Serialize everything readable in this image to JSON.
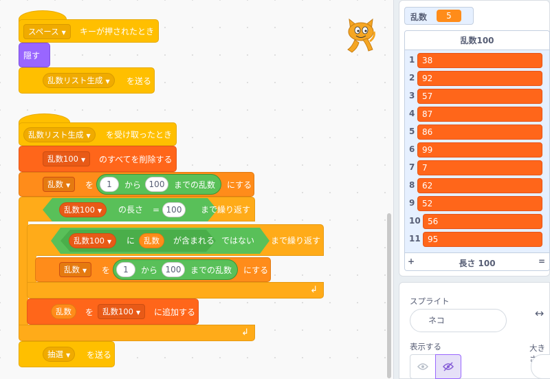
{
  "scripts": {
    "s1": {
      "hat_key_dropdown": "スペース",
      "hat_text": "キーが押されたとき",
      "hide_label": "隠す",
      "broadcast_dropdown": "乱数リスト生成",
      "broadcast_text": "を送る"
    },
    "s2": {
      "hat_dropdown": "乱数リスト生成",
      "hat_text": "を受け取ったとき",
      "delete_all_list": "乱数100",
      "delete_all_text": "のすべてを削除する",
      "set_var": "乱数",
      "set_to": "を",
      "rand_from": "1",
      "rand_kara": "から",
      "rand_to": "100",
      "rand_text": "までの乱数",
      "set_suffix": "にする",
      "repeat_until_list": "乱数100",
      "length_of": "の長さ",
      "eq": "=",
      "eq_value": "100",
      "repeat_until_text": "まで繰り返す",
      "inner_list": "乱数100",
      "ni": "に",
      "contains_var": "乱数",
      "contains_text": "が含まれる",
      "not_text": "ではない",
      "inner_repeat_text": "まで繰り返す",
      "inner_set_var": "乱数",
      "inner_set_to": "を",
      "inner_rand_from": "1",
      "inner_rand_kara": "から",
      "inner_rand_to": "100",
      "inner_rand_text": "までの乱数",
      "inner_set_suffix": "にする",
      "add_var": "乱数",
      "add_wo": "を",
      "add_list": "乱数100",
      "add_text": "に追加する",
      "broadcast_dropdown": "抽選",
      "broadcast_text": "を送る"
    }
  },
  "stage": {
    "var_monitor": {
      "name": "乱数",
      "value": "5"
    },
    "list_monitor": {
      "title": "乱数100",
      "items": [
        {
          "i": "1",
          "v": "38"
        },
        {
          "i": "2",
          "v": "92"
        },
        {
          "i": "3",
          "v": "57"
        },
        {
          "i": "4",
          "v": "87"
        },
        {
          "i": "5",
          "v": "86"
        },
        {
          "i": "6",
          "v": "99"
        },
        {
          "i": "7",
          "v": "7"
        },
        {
          "i": "8",
          "v": "62"
        },
        {
          "i": "9",
          "v": "52"
        },
        {
          "i": "10",
          "v": "56"
        },
        {
          "i": "11",
          "v": "95"
        }
      ],
      "add": "+",
      "length": "長さ 100",
      "eq": "="
    }
  },
  "sprite_info": {
    "sprite_label": "スプライト",
    "sprite_name": "ネコ",
    "show_label": "表示する",
    "size_label": "大きさ"
  },
  "colors": {
    "events": "#ffbf00",
    "looks": "#9966ff",
    "list": "#ff661a",
    "operators": "#59c059"
  }
}
